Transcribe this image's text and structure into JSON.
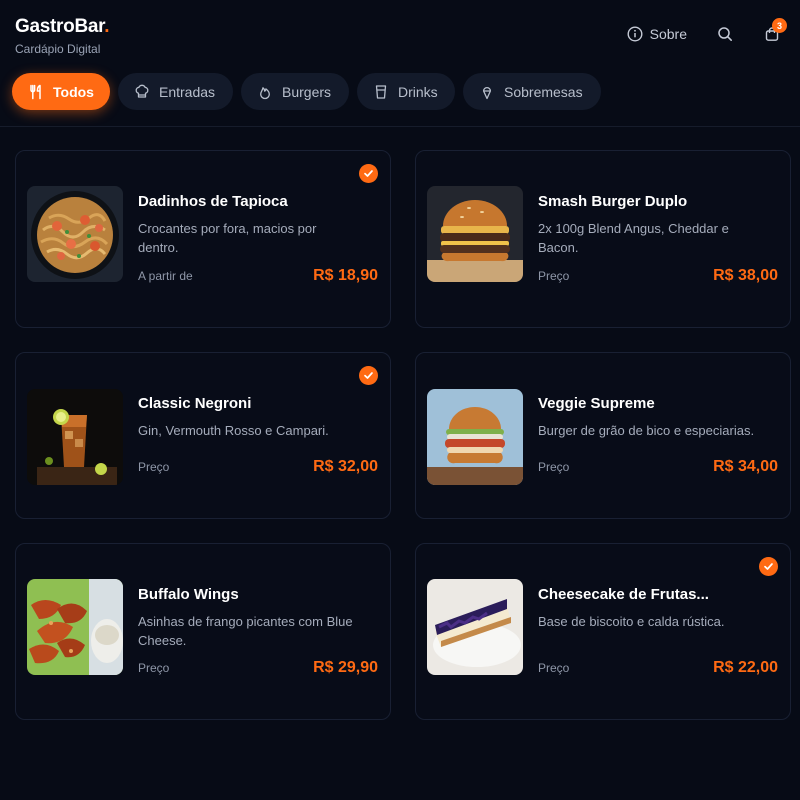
{
  "brand": {
    "name": "GastroBar",
    "dot": ".",
    "subtitle": "Cardápio Digital"
  },
  "header": {
    "about_label": "Sobre",
    "cart_count": "3"
  },
  "tabs": [
    {
      "label": "Todos",
      "icon": "fork-knife-icon",
      "active": true
    },
    {
      "label": "Entradas",
      "icon": "chef-hat-icon",
      "active": false
    },
    {
      "label": "Burgers",
      "icon": "flame-icon",
      "active": false
    },
    {
      "label": "Drinks",
      "icon": "cup-icon",
      "active": false
    },
    {
      "label": "Sobremesas",
      "icon": "ice-cream-icon",
      "active": false
    }
  ],
  "colors": {
    "accent": "#ff6a13",
    "background": "#070b16",
    "card": "#080c18"
  },
  "products": [
    {
      "name": "Dadinhos de Tapioca",
      "description": "Crocantes por fora, macios por dentro.",
      "price_label": "A partir de",
      "price": "R$ 18,90",
      "selected": true
    },
    {
      "name": "Smash Burger Duplo",
      "description": "2x 100g Blend Angus, Cheddar e Bacon.",
      "price_label": "Preço",
      "price": "R$ 38,00",
      "selected": false
    },
    {
      "name": "Classic Negroni",
      "description": "Gin, Vermouth Rosso e Campari.",
      "price_label": "Preço",
      "price": "R$ 32,00",
      "selected": true
    },
    {
      "name": "Veggie Supreme",
      "description": "Burger de grão de bico e especiarias.",
      "price_label": "Preço",
      "price": "R$ 34,00",
      "selected": false
    },
    {
      "name": "Buffalo Wings",
      "description": "Asinhas de frango picantes com Blue Cheese.",
      "price_label": "Preço",
      "price": "R$ 29,90",
      "selected": false
    },
    {
      "name": "Cheesecake de Frutas...",
      "description": "Base de biscoito e calda rústica.",
      "price_label": "Preço",
      "price": "R$ 22,00",
      "selected": true
    }
  ]
}
